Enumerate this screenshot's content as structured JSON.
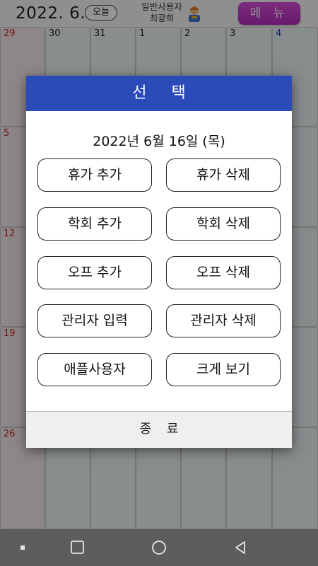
{
  "header": {
    "year_month": "2022. 6.",
    "today_label": "오늘",
    "user_type": "일반사용자",
    "user_name": "최광희",
    "menu_label": "메 뉴"
  },
  "calendar": {
    "weeks": [
      [
        "29",
        "30",
        "31",
        "1",
        "2",
        "3",
        "4"
      ],
      [
        "5",
        "",
        "",
        "",
        "",
        "",
        ""
      ],
      [
        "12",
        "",
        "",
        "",
        "",
        "",
        ""
      ],
      [
        "19",
        "",
        "",
        "",
        "",
        "",
        ""
      ],
      [
        "26",
        "",
        "",
        "",
        "",
        "",
        ""
      ]
    ]
  },
  "dialog": {
    "title": "선 택",
    "date": "2022년 6월 16일 (목)",
    "buttons": [
      "휴가 추가",
      "휴가 삭제",
      "학회 추가",
      "학회 삭제",
      "오프 추가",
      "오프 삭제",
      "관리자 입력",
      "관리자 삭제",
      "애플사용자",
      "크게 보기"
    ],
    "close_label": "종 료"
  },
  "navbar": {
    "icons": [
      "recents-dot-icon",
      "home-square-icon",
      "home-circle-icon",
      "back-triangle-icon"
    ]
  }
}
